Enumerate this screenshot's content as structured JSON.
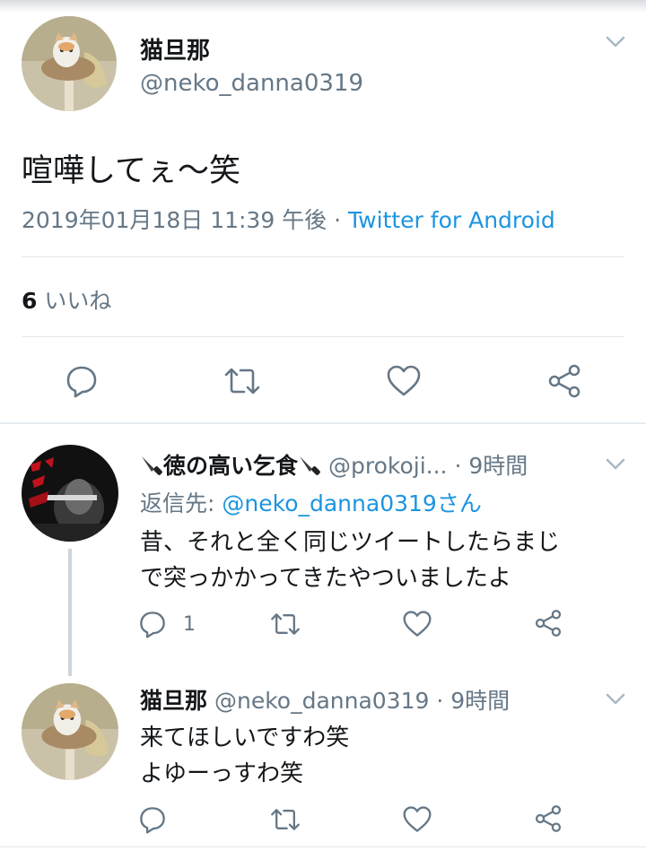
{
  "main_tweet": {
    "author_name": "猫旦那",
    "author_handle": "@neko_danna0319",
    "text": "喧嘩してぇ〜笑",
    "timestamp": "2019年01月18日 11:39 午後",
    "separator": "·",
    "source": "Twitter for Android",
    "likes_count": "6",
    "likes_label": "いいね"
  },
  "reply_1": {
    "author_name": "徳の高い乞食",
    "author_handle": "@prokoji...",
    "time": "· 9時間",
    "reply_to_label": "返信先:",
    "reply_to_handle": "@neko_danna0319さん",
    "text_line1": "昔、それと全く同じツイートしたらまじ",
    "text_line2": "で突っかかってきたやついましたよ",
    "reply_count": "1"
  },
  "reply_2": {
    "author_name": "猫旦那",
    "author_handle": "@neko_danna0319",
    "time": "· 9時間",
    "text_line1": "来てほしいですわ笑",
    "text_line2": "よゆーっすわ笑"
  },
  "colors": {
    "link": "#1b95e0",
    "secondary": "#657786",
    "icon": "#657786",
    "divider": "#e1e8ed"
  }
}
